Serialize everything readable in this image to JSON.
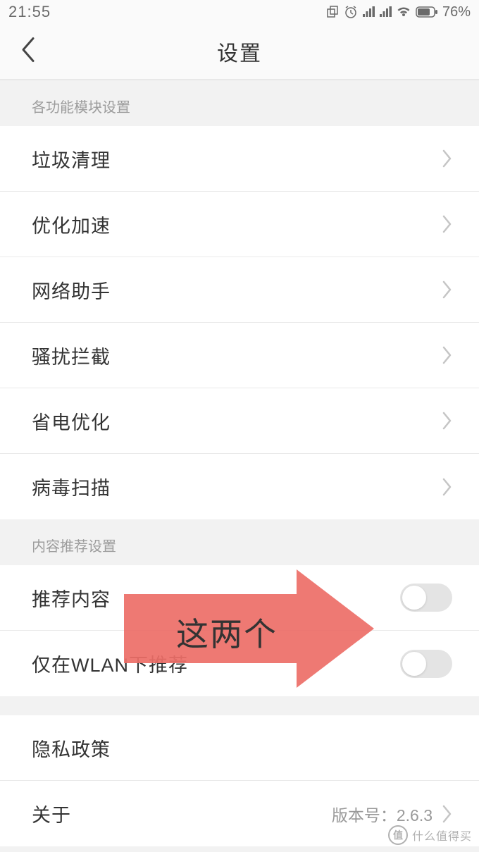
{
  "status": {
    "time": "21:55",
    "battery": "76%"
  },
  "header": {
    "title": "设置"
  },
  "section1": {
    "header": "各功能模块设置",
    "items": [
      {
        "label": "垃圾清理"
      },
      {
        "label": "优化加速"
      },
      {
        "label": "网络助手"
      },
      {
        "label": "骚扰拦截"
      },
      {
        "label": "省电优化"
      },
      {
        "label": "病毒扫描"
      }
    ]
  },
  "section2": {
    "header": "内容推荐设置",
    "items": [
      {
        "label": "推荐内容"
      },
      {
        "label": "仅在WLAN下推荐"
      }
    ]
  },
  "section3": {
    "items": [
      {
        "label": "隐私政策",
        "value": ""
      },
      {
        "label": "关于",
        "value": "版本号：2.6.3"
      }
    ]
  },
  "annotation": {
    "text": "这两个"
  },
  "watermark": {
    "badge": "值",
    "text": "什么值得买"
  }
}
